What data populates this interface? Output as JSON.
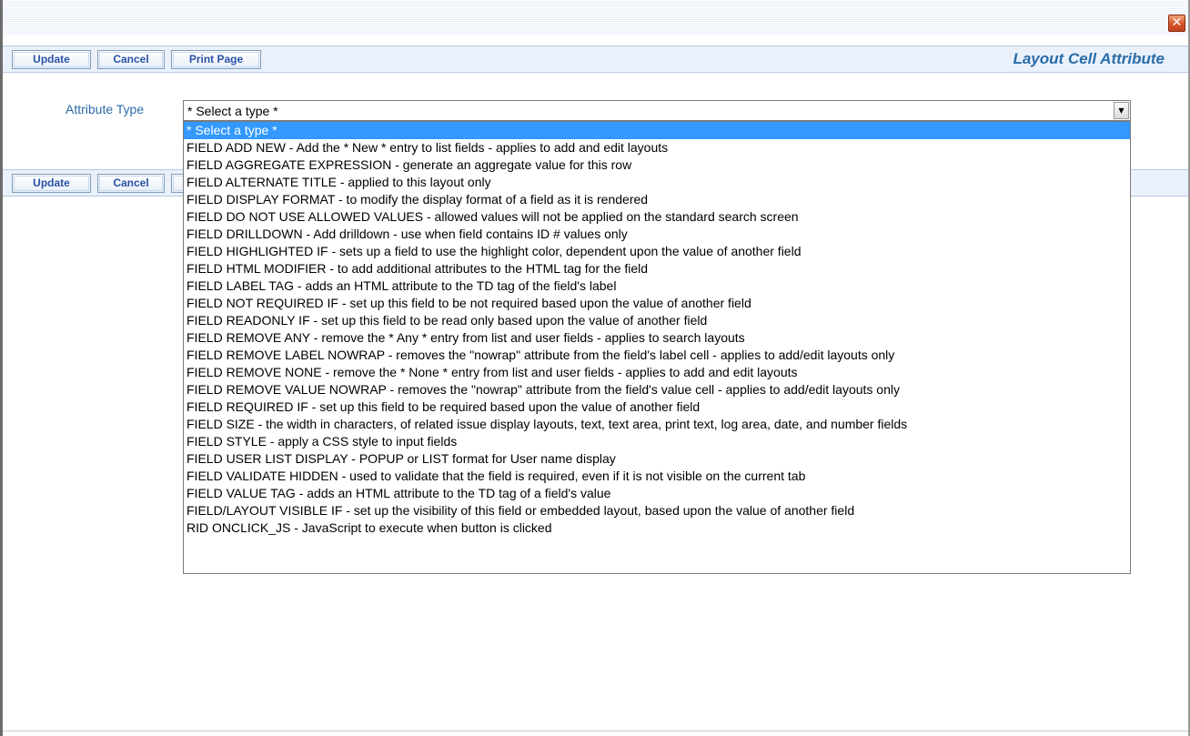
{
  "window": {
    "close_label": "✕"
  },
  "toolbar_top": {
    "update_label": "Update",
    "cancel_label": "Cancel",
    "print_label": "Print Page",
    "title": "Layout Cell Attribute"
  },
  "toolbar_bottom": {
    "update_label": "Update",
    "cancel_label": "Cancel"
  },
  "form": {
    "attribute_type_label": "Attribute Type",
    "attribute_type_value": "* Select a type *"
  },
  "dropdown": {
    "selected_index": 0,
    "options": [
      "* Select a type *",
      "FIELD ADD NEW - Add the * New * entry to list fields - applies to add and edit layouts",
      "FIELD AGGREGATE EXPRESSION - generate an aggregate value for this row",
      "FIELD ALTERNATE TITLE - applied to this layout only",
      "FIELD DISPLAY FORMAT - to modify the display format of a field as it is rendered",
      "FIELD DO NOT USE ALLOWED VALUES - allowed values will not be applied on the standard search screen",
      "FIELD DRILLDOWN - Add drilldown - use when field contains ID # values only",
      "FIELD HIGHLIGHTED IF - sets up a field to use the highlight color, dependent upon the value of another field",
      "FIELD HTML MODIFIER - to add additional attributes to the HTML tag for the field",
      "FIELD LABEL TAG - adds an HTML attribute to the TD tag of the field's label",
      "FIELD NOT REQUIRED IF - set up this field to be not required based upon the value of another field",
      "FIELD READONLY IF - set up this field to be read only based upon the value of another field",
      "FIELD REMOVE ANY - remove the * Any * entry from list and user fields - applies to search layouts",
      "FIELD REMOVE LABEL NOWRAP - removes the \"nowrap\" attribute from the field's label cell - applies to add/edit layouts only",
      "FIELD REMOVE NONE - remove the * None * entry from list and user fields - applies to add and edit layouts",
      "FIELD REMOVE VALUE NOWRAP - removes the \"nowrap\" attribute from the field's value cell - applies to add/edit layouts only",
      "FIELD REQUIRED IF - set up this field to be required based upon the value of another field",
      "FIELD SIZE - the width in characters, of related issue display layouts, text, text area, print text, log area, date, and number fields",
      "FIELD STYLE - apply a CSS style to input fields",
      "FIELD USER LIST DISPLAY - POPUP or LIST format for User name display",
      "FIELD VALIDATE HIDDEN - used to validate that the field is required, even if it is not visible on the current tab",
      "FIELD VALUE TAG - adds an HTML attribute to the TD tag of a field's value",
      "FIELD/LAYOUT VISIBLE IF - set up the visibility of this field or embedded layout, based upon the value of another field",
      "RID ONCLICK_JS - JavaScript to execute when button is clicked"
    ]
  }
}
